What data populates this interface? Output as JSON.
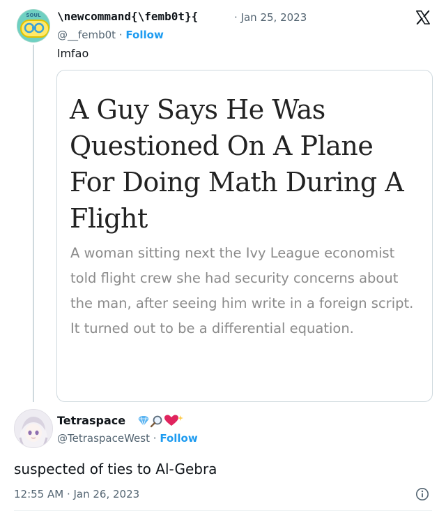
{
  "tweet": {
    "author_name": "\\newcommand{\\femb0t}{",
    "separator": "·",
    "date": "Jan 25, 2023",
    "handle": "@__femb0t",
    "follow_label": "Follow",
    "text": "lmfao",
    "avatar_text": "SOUL"
  },
  "article": {
    "headline": "A Guy Says He Was Questioned On A Plane For Doing Math During A Flight",
    "summary": "A woman sitting next the Ivy League economist told flight crew she had security concerns about the man, after seeing him write in a foreign script. It turned out to be a differential equation."
  },
  "reply": {
    "author_name": "Tetraspace",
    "handle": "@TetraspaceWest",
    "separator": "·",
    "follow_label": "Follow",
    "text": "suspected of ties to Al-Gebra",
    "timestamp": "12:55 AM · Jan 26, 2023"
  },
  "colors": {
    "link_blue": "#1d9bf0",
    "muted_text": "#536471",
    "body_text": "#0f1419",
    "border": "#cfd9de",
    "diamond_badge": "#5ab4f2",
    "heart_badge": "#e0245e"
  },
  "icons": {
    "platform_logo": "x-logo-icon",
    "info": "info-circle-icon",
    "badges": [
      "diamond-icon",
      "magnifier-icon",
      "sparkling-heart-icon"
    ]
  }
}
